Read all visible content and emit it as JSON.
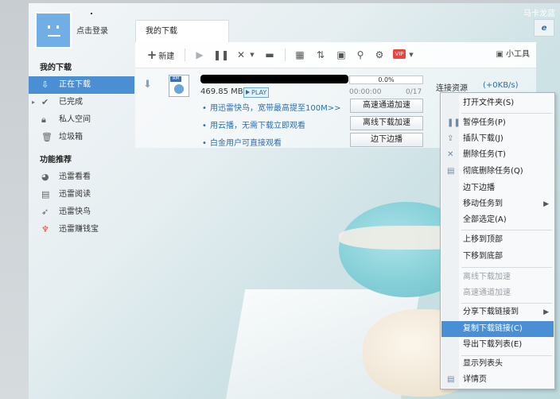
{
  "corner_label": "马卡龙蓝",
  "user": {
    "login_label": "点击登录"
  },
  "sidebar": {
    "section1_title": "我的下载",
    "items": [
      {
        "label": "正在下载",
        "icon": "download-icon"
      },
      {
        "label": "已完成",
        "icon": "check-icon"
      },
      {
        "label": "私人空间",
        "icon": "lock-icon"
      },
      {
        "label": "垃圾箱",
        "icon": "trash-icon"
      }
    ],
    "section2_title": "功能推荐",
    "features": [
      {
        "label": "迅雷看看",
        "icon": "video-icon"
      },
      {
        "label": "迅雷阅读",
        "icon": "book-icon"
      },
      {
        "label": "迅雷快鸟",
        "icon": "bird-icon"
      },
      {
        "label": "迅雷赚钱宝",
        "icon": "treasure-icon"
      }
    ]
  },
  "tab": {
    "label": "我的下载"
  },
  "toolbar": {
    "new_label": "新建",
    "vip_label": "VIP",
    "tools_label": "小工具"
  },
  "task": {
    "size": "469.85 MB",
    "play_label": "PLAY",
    "progress_text": "0.0%",
    "progress": 0.0,
    "elapsed": "00:00:00",
    "count": "0/17",
    "source_label": "连接资源",
    "speed": "(+0KB/s)",
    "tips": [
      "用迅雷快鸟，宽带最高提至100M>>",
      "用云播，无需下载立即观看",
      "白金用户可直接观看"
    ],
    "buttons": [
      "高速通道加速",
      "离线下载加速",
      "边下边播"
    ]
  },
  "context_menu": {
    "items": [
      {
        "label": "打开文件夹(S)",
        "enabled": true
      },
      {
        "label": "暂停任务(P)",
        "enabled": true,
        "icon": "pause-icon"
      },
      {
        "label": "插队下载(J)",
        "enabled": true,
        "icon": "jump-queue-icon"
      },
      {
        "label": "删除任务(T)",
        "enabled": true,
        "icon": "delete-icon"
      },
      {
        "label": "彻底删除任务(Q)",
        "enabled": true,
        "icon": "delete-permanently-icon"
      },
      {
        "label": "边下边播",
        "enabled": true
      },
      {
        "label": "移动任务到",
        "enabled": true,
        "submenu": true
      },
      {
        "label": "全部选定(A)",
        "enabled": true
      },
      {
        "label": "上移到顶部",
        "enabled": true
      },
      {
        "label": "下移到底部",
        "enabled": true
      },
      {
        "label": "离线下载加速",
        "enabled": false
      },
      {
        "label": "高速通道加速",
        "enabled": false
      },
      {
        "label": "分享下载链接到",
        "enabled": true,
        "submenu": true
      },
      {
        "label": "复制下载链接(C)",
        "enabled": true,
        "highlighted": true
      },
      {
        "label": "导出下载列表(E)",
        "enabled": true
      },
      {
        "label": "显示列表头",
        "enabled": true
      },
      {
        "label": "详情页",
        "enabled": true,
        "icon": "details-icon"
      }
    ]
  }
}
